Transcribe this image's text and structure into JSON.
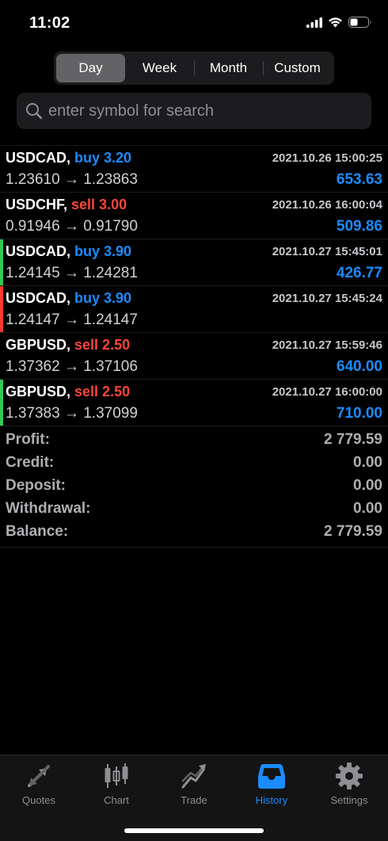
{
  "status_bar": {
    "time": "11:02"
  },
  "segments": [
    {
      "label": "Day",
      "active": true
    },
    {
      "label": "Week",
      "active": false
    },
    {
      "label": "Month",
      "active": false
    },
    {
      "label": "Custom",
      "active": false
    }
  ],
  "search": {
    "placeholder": "enter symbol for search"
  },
  "deals": [
    {
      "symbol": "USDCAD,",
      "side": "buy 3.20",
      "side_type": "buy",
      "time": "2021.10.26 15:00:25",
      "prices": "1.23610 → 1.23863",
      "profit": "653.63",
      "bar": ""
    },
    {
      "symbol": "USDCHF,",
      "side": "sell 3.00",
      "side_type": "sell",
      "time": "2021.10.26 16:00:04",
      "prices": "0.91946 → 0.91790",
      "profit": "509.86",
      "bar": ""
    },
    {
      "symbol": "USDCAD,",
      "side": "buy 3.90",
      "side_type": "buy",
      "time": "2021.10.27 15:45:01",
      "prices": "1.24145 → 1.24281",
      "profit": "426.77",
      "bar": "green"
    },
    {
      "symbol": "USDCAD,",
      "side": "buy 3.90",
      "side_type": "buy",
      "time": "2021.10.27 15:45:24",
      "prices": "1.24147 → 1.24147",
      "profit": "",
      "bar": "red"
    },
    {
      "symbol": "GBPUSD,",
      "side": "sell 2.50",
      "side_type": "sell",
      "time": "2021.10.27 15:59:46",
      "prices": "1.37362 → 1.37106",
      "profit": "640.00",
      "bar": ""
    },
    {
      "symbol": "GBPUSD,",
      "side": "sell 2.50",
      "side_type": "sell",
      "time": "2021.10.27 16:00:00",
      "prices": "1.37383 → 1.37099",
      "profit": "710.00",
      "bar": "green"
    }
  ],
  "summary": [
    {
      "label": "Profit:",
      "value": "2 779.59"
    },
    {
      "label": "Credit:",
      "value": "0.00"
    },
    {
      "label": "Deposit:",
      "value": "0.00"
    },
    {
      "label": "Withdrawal:",
      "value": "0.00"
    },
    {
      "label": "Balance:",
      "value": "2 779.59"
    }
  ],
  "tabs": [
    {
      "label": "Quotes",
      "icon": "quotes-icon",
      "active": false
    },
    {
      "label": "Chart",
      "icon": "chart-icon",
      "active": false
    },
    {
      "label": "Trade",
      "icon": "trade-icon",
      "active": false
    },
    {
      "label": "History",
      "icon": "history-icon",
      "active": true
    },
    {
      "label": "Settings",
      "icon": "settings-icon",
      "active": false
    }
  ],
  "colors": {
    "accent": "#1a8cff",
    "sell": "#ff453a",
    "bar_green": "#34c759",
    "bar_red": "#ff3b30"
  }
}
